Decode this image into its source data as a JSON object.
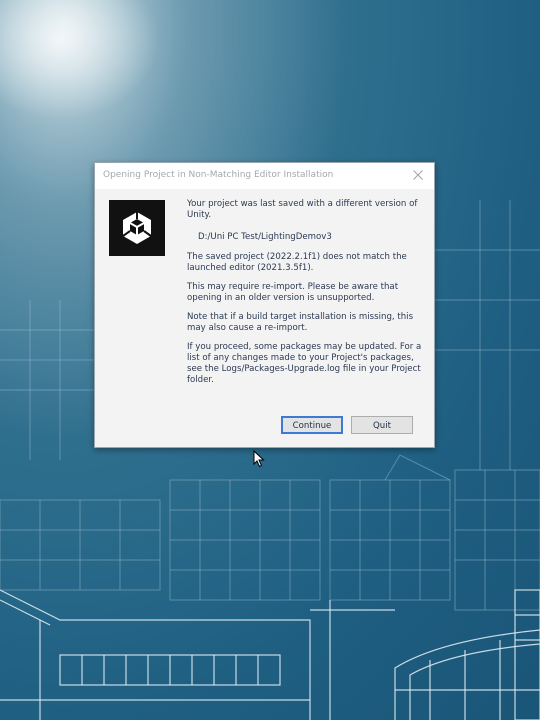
{
  "dialog": {
    "title": "Opening Project in Non-Matching Editor Installation",
    "close_icon": "close-icon",
    "logo_icon": "unity-logo-icon",
    "message_intro": "Your project was last saved with a different version of Unity.",
    "project_path": "D:/Uni PC Test/LightingDemov3",
    "version_mismatch": "The saved project (2022.2.1f1) does not match the launched editor (2021.3.5f1).",
    "reimport_warning": "This may require re-import. Please be aware that opening in an older version is unsupported.",
    "build_target_note": "Note that if a build target installation is missing, this may also cause a re-import.",
    "packages_note": "If you proceed, some packages may be updated. For a list of any changes made to your Project's packages, see the Logs/Packages-Upgrade.log file in your Project folder.",
    "continue_label": "Continue",
    "quit_label": "Quit"
  },
  "colors": {
    "desktop": "#1f5f82",
    "dialog_bg": "#f3f3f3",
    "default_button_border": "#3c7ad6",
    "text": "#2c3a52"
  }
}
